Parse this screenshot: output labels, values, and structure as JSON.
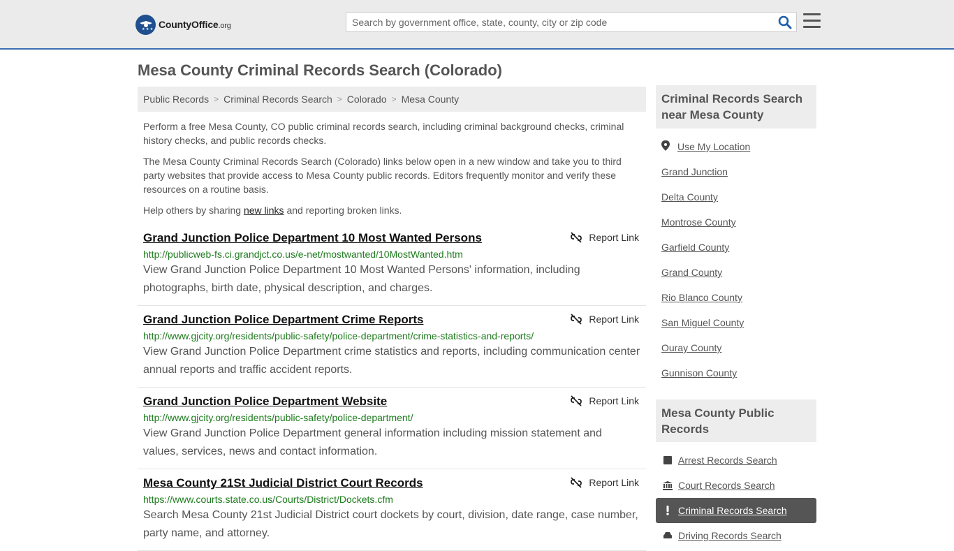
{
  "header": {
    "logo_brand": "CountyOffice",
    "logo_tld": ".org",
    "search_placeholder": "Search by government office, state, county, city or zip code"
  },
  "page_title": "Mesa County Criminal Records Search (Colorado)",
  "breadcrumb": [
    "Public Records",
    "Criminal Records Search",
    "Colorado",
    "Mesa County"
  ],
  "intro": {
    "p1": "Perform a free Mesa County, CO public criminal records search, including criminal background checks, criminal history checks, and public records checks.",
    "p2": "The Mesa County Criminal Records Search (Colorado) links below open in a new window and take you to third party websites that provide access to Mesa County public records. Editors frequently monitor and verify these resources on a routine basis.",
    "p3_before": "Help others by sharing ",
    "p3_link": "new links",
    "p3_after": " and reporting broken links."
  },
  "report_label": "Report Link",
  "results": [
    {
      "title": "Grand Junction Police Department 10 Most Wanted Persons",
      "url": "http://publicweb-fs.ci.grandjct.co.us/e-net/mostwanted/10MostWanted.htm",
      "desc": "View Grand Junction Police Department 10 Most Wanted Persons' information, including photographs, birth date, physical description, and charges."
    },
    {
      "title": "Grand Junction Police Department Crime Reports",
      "url": "http://www.gjcity.org/residents/public-safety/police-department/crime-statistics-and-reports/",
      "desc": "View Grand Junction Police Department crime statistics and reports, including communication center annual reports and traffic accident reports."
    },
    {
      "title": "Grand Junction Police Department Website",
      "url": "http://www.gjcity.org/residents/public-safety/police-department/",
      "desc": "View Grand Junction Police Department general information including mission statement and values, services, news and contact information."
    },
    {
      "title": "Mesa County 21St Judicial District Court Records",
      "url": "https://www.courts.state.co.us/Courts/District/Dockets.cfm",
      "desc": "Search Mesa County 21st Judicial District court dockets by court, division, date range, case number, party name, and attorney."
    }
  ],
  "sidebar": {
    "nearby_heading": "Criminal Records Search near Mesa County",
    "use_location": "Use My Location",
    "nearby": [
      "Grand Junction",
      "Delta County",
      "Montrose County",
      "Garfield County",
      "Grand County",
      "Rio Blanco County",
      "San Miguel County",
      "Ouray County",
      "Gunnison County"
    ],
    "records_heading": "Mesa County Public Records",
    "records": [
      {
        "label": "Arrest Records Search",
        "icon": "square-icon",
        "active": false
      },
      {
        "label": "Court Records Search",
        "icon": "courthouse-icon",
        "active": false
      },
      {
        "label": "Criminal Records Search",
        "icon": "exclamation-icon",
        "active": true
      },
      {
        "label": "Driving Records Search",
        "icon": "car-icon",
        "active": false
      }
    ]
  }
}
